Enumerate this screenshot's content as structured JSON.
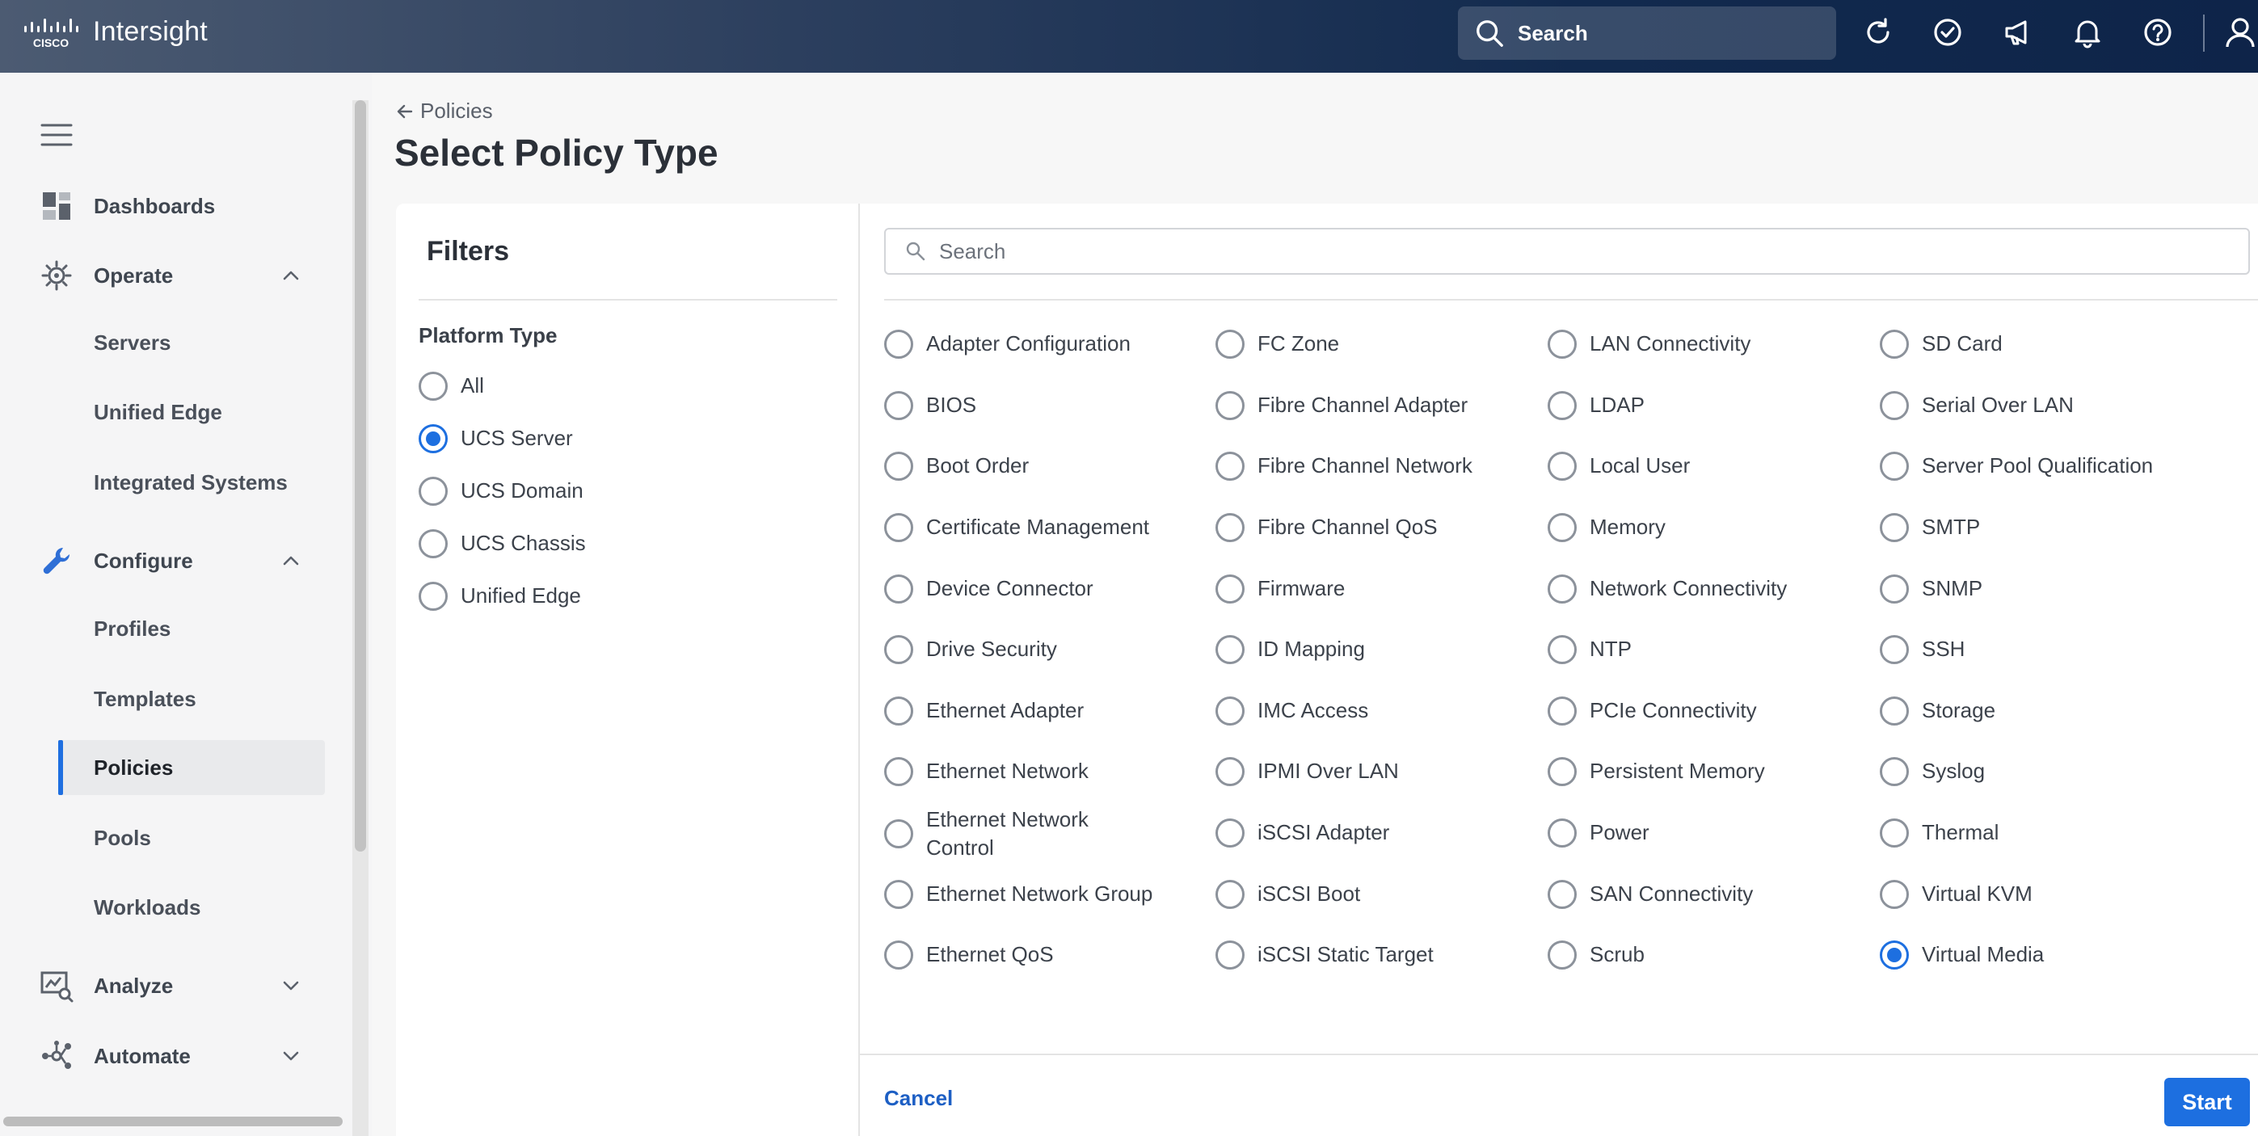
{
  "header": {
    "brand": "Intersight",
    "search_label": "Search",
    "colors": {
      "bar_left": "#4c5b72",
      "bar_right": "#0e2449"
    }
  },
  "sidebar": {
    "sections": [
      {
        "label": "Dashboards",
        "icon": "dashboard-icon"
      },
      {
        "label": "Operate",
        "icon": "operate-icon",
        "expanded": true,
        "items": [
          "Servers",
          "Unified Edge",
          "Integrated Systems"
        ]
      },
      {
        "label": "Configure",
        "icon": "configure-icon",
        "expanded": true,
        "items": [
          "Profiles",
          "Templates",
          "Policies",
          "Pools",
          "Workloads"
        ]
      },
      {
        "label": "Analyze",
        "icon": "analyze-icon",
        "expanded": false
      },
      {
        "label": "Automate",
        "icon": "automate-icon",
        "expanded": false
      }
    ],
    "active_item": "Policies"
  },
  "page": {
    "back_label": "Policies",
    "title": "Select Policy Type"
  },
  "filters": {
    "title": "Filters",
    "platform_title": "Platform Type",
    "options": [
      "All",
      "UCS Server",
      "UCS Domain",
      "UCS Chassis",
      "Unified Edge"
    ],
    "selected": "UCS Server"
  },
  "policy_types": {
    "search_placeholder": "Search",
    "columns": [
      [
        "Adapter Configuration",
        "BIOS",
        "Boot Order",
        "Certificate Management",
        "Device Connector",
        "Drive Security",
        "Ethernet Adapter",
        "Ethernet Network",
        "Ethernet Network Control",
        "Ethernet Network Group",
        "Ethernet QoS"
      ],
      [
        "FC Zone",
        "Fibre Channel Adapter",
        "Fibre Channel Network",
        "Fibre Channel QoS",
        "Firmware",
        "ID Mapping",
        "IMC Access",
        "IPMI Over LAN",
        "iSCSI Adapter",
        "iSCSI Boot",
        "iSCSI Static Target"
      ],
      [
        "LAN Connectivity",
        "LDAP",
        "Local User",
        "Memory",
        "Network Connectivity",
        "NTP",
        "PCIe Connectivity",
        "Persistent Memory",
        "Power",
        "SAN Connectivity",
        "Scrub"
      ],
      [
        "SD Card",
        "Serial Over LAN",
        "Server Pool Qualification",
        "SMTP",
        "SNMP",
        "SSH",
        "Storage",
        "Syslog",
        "Thermal",
        "Virtual KVM",
        "Virtual Media"
      ]
    ],
    "selected": "Virtual Media"
  },
  "footer": {
    "cancel_label": "Cancel",
    "start_label": "Start",
    "accent_color": "#1d6fe0"
  }
}
